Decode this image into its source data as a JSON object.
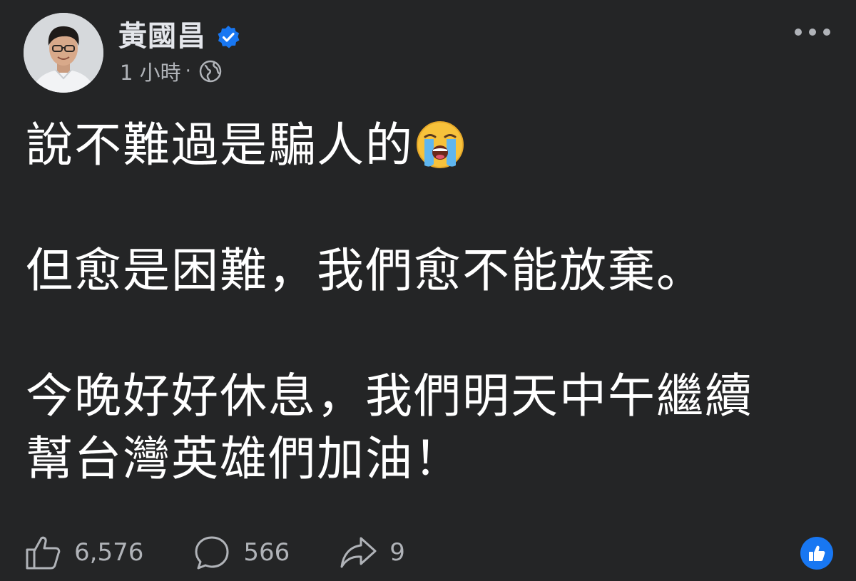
{
  "post": {
    "author": "黃國昌",
    "timestamp": "1 小時",
    "separator": "·",
    "audience_icon": "globe-icon",
    "verified_icon": "verified-badge-icon",
    "body": {
      "line1": "說不難過是騙人的",
      "line1_emoji": "loudly-crying-face-emoji",
      "line2": "但愈是困難，我們愈不能放棄。",
      "line3": "今晚好好休息，我們明天中午繼續",
      "line4": "幫台灣英雄們加油！"
    }
  },
  "footer": {
    "likes": "6,576",
    "comments": "566",
    "shares": "9",
    "like_icon": "thumbs-up-icon",
    "comment_icon": "comment-bubble-icon",
    "share_icon": "share-arrow-icon",
    "reaction_icon": "like-reaction-icon"
  },
  "colors": {
    "background": "#242526",
    "primary_text": "#ffffff",
    "secondary_text": "#b0b3b8",
    "accent": "#1877f2"
  }
}
